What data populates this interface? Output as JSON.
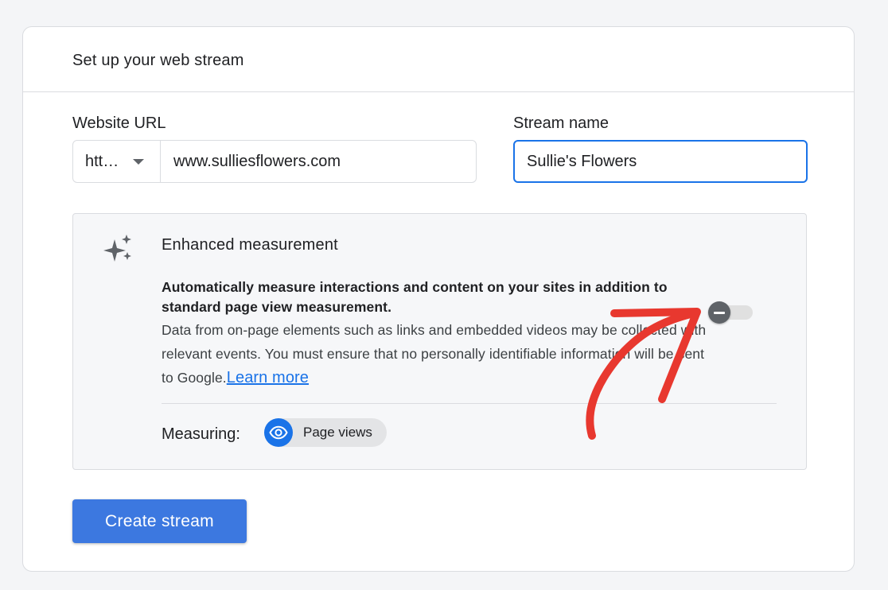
{
  "header": {
    "title": "Set up your web stream"
  },
  "form": {
    "website_url_label": "Website URL",
    "protocol_value": "htt…",
    "url_value": "www.sulliesflowers.com",
    "stream_name_label": "Stream name",
    "stream_name_value": "Sullie's Flowers"
  },
  "enhanced": {
    "title": "Enhanced measurement",
    "bold_text": "Automatically measure interactions and content on your sites in addition to standard page view measurement.",
    "description": "Data from on-page elements such as links and embedded videos may be collected with relevant events. You must ensure that no personally identifiable information will be sent to Google.",
    "learn_more": "Learn more",
    "toggle_state": "off",
    "measuring_label": "Measuring:",
    "chip_label": "Page views"
  },
  "actions": {
    "create_label": "Create stream"
  },
  "colors": {
    "accent": "#1a73e8",
    "button": "#3c78e0",
    "annotation_arrow": "#e8382f"
  },
  "icons": {
    "sparkle": "sparkle-icon",
    "eye": "eye-icon",
    "caret": "caret-down-icon"
  }
}
